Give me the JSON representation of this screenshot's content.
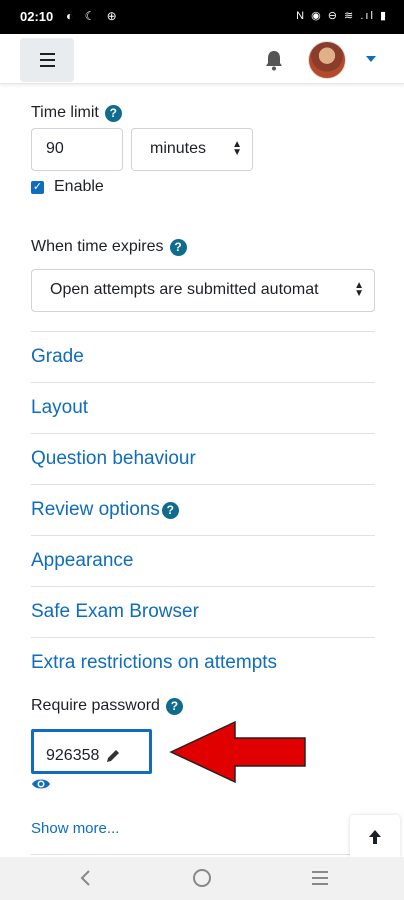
{
  "statusbar": {
    "time": "02:10",
    "left_icons": "◐ ☾ ⊕",
    "right_icons": "N ◉ ⊖ ≋ .ıl ▮"
  },
  "navbar": {
    "menu_icon": "hamburger-icon",
    "bell_icon": "bell-icon",
    "user_menu_icon": "caret-down-icon"
  },
  "colors": {
    "link": "#0f6cbf",
    "help": "#0f6c8c",
    "arrow": "#e00000"
  },
  "time_limit": {
    "label": "Time limit",
    "value": "90",
    "unit": "minutes",
    "enable_label": "Enable"
  },
  "when_time_expires": {
    "label": "When time expires",
    "value": "Open attempts are submitted automat"
  },
  "sections": [
    {
      "label": "Grade"
    },
    {
      "label": "Layout"
    },
    {
      "label": "Question behaviour"
    },
    {
      "label": "Review options"
    },
    {
      "label": "Appearance"
    },
    {
      "label": "Safe Exam Browser"
    },
    {
      "label": "Extra restrictions on attempts"
    }
  ],
  "password": {
    "label": "Require password",
    "value": "926358"
  },
  "show_more": "Show more...",
  "help_glyph": "?"
}
